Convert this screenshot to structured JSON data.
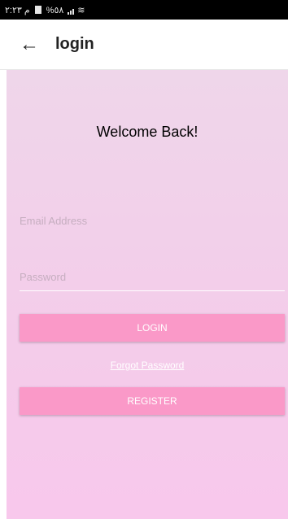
{
  "status_bar": {
    "time": "م ٢:٢٣",
    "battery": "%٥٨"
  },
  "app_bar": {
    "back_icon": "arrow-back-icon",
    "back_glyph": "←",
    "title": "login"
  },
  "form": {
    "heading": "Welcome Back!",
    "email_placeholder": "Email Address",
    "password_placeholder": "Password",
    "login_label": "LOGIN",
    "forgot_label": "Forgot Password",
    "register_label": "REGISTER"
  },
  "colors": {
    "button": "#fa99c8",
    "background_top": "#efd6ea",
    "background_bottom": "#f8c8ec"
  }
}
